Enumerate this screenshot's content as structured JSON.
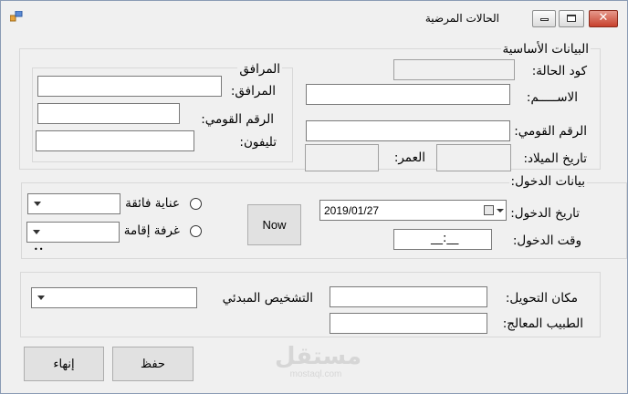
{
  "window": {
    "title": "الحالات المرضية",
    "close_glyph": "✕"
  },
  "basic": {
    "title": "البيانات الأساسية",
    "case_code_label": "كود الحالة:",
    "name_label": "الاســـــم:",
    "national_id_label": "الرقم القومي:",
    "birth_date_label": "تاريخ الميلاد:",
    "age_label": "العمر:"
  },
  "companion": {
    "title": "المرافق",
    "name_label": "المرافق:",
    "national_id_label": "الرقم القومي:",
    "phone_label": "تليفون:"
  },
  "admission": {
    "title": "بيانات الدخول:",
    "date_label": "تاريخ الدخول:",
    "date_value": "2019/01/27",
    "time_label": "وقت الدخول:",
    "time_value": "__:__",
    "icu_label": "عناية فائقة",
    "room_label": "غرفة إقامة",
    "now_button": "Now",
    "dots": "••"
  },
  "referral": {
    "place_label": "مكان التحويل:",
    "doctor_label": "الطبيب المعالج:",
    "diagnosis_label": "التشخيص المبدئي"
  },
  "actions": {
    "save": "حفظ",
    "end": "إنهاء"
  },
  "watermark": {
    "arabic": "مستقل",
    "latin": "mostaql.com"
  }
}
